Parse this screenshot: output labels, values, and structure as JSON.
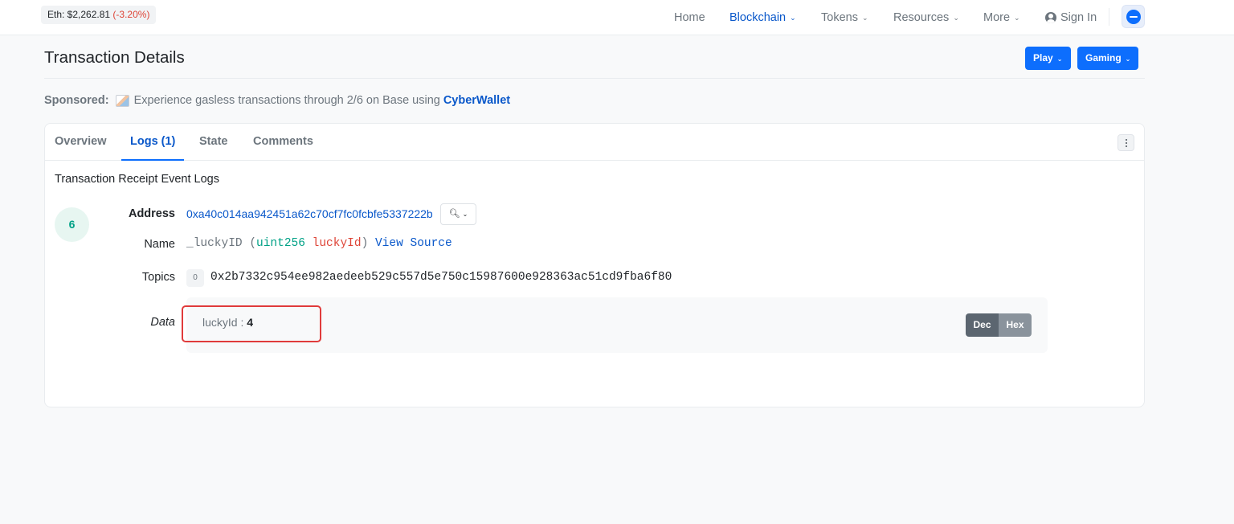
{
  "topbar": {
    "eth_price_label": "Eth: $2,262.81",
    "eth_change": "(-3.20%)",
    "nav": {
      "home": "Home",
      "blockchain": "Blockchain",
      "tokens": "Tokens",
      "resources": "Resources",
      "more": "More",
      "sign_in": "Sign In"
    }
  },
  "header": {
    "title": "Transaction Details",
    "play_button": "Play",
    "gaming_button": "Gaming"
  },
  "sponsored": {
    "label": "Sponsored:",
    "text": "Experience gasless transactions through 2/6 on Base using",
    "brand": "CyberWallet"
  },
  "tabs": [
    "Overview",
    "Logs (1)",
    "State",
    "Comments"
  ],
  "active_tab": "Logs (1)",
  "logs": {
    "heading": "Transaction Receipt Event Logs",
    "entry": {
      "index": "6",
      "address_label": "Address",
      "address": "0xa40c014aa942451a62c70cf7fc0fcbfe5337222b",
      "name_label": "Name",
      "function_name": "_luckyID",
      "param_type": "uint256",
      "param_name": "luckyId",
      "view_source": "View Source",
      "topics_label": "Topics",
      "topic_index": "0",
      "topic_hash": "0x2b7332c954ee982aedeeb529c557d5e750c15987600e928363ac51cd9fba6f80",
      "data_label": "Data",
      "data_key": "luckyId",
      "data_value": "4",
      "dec_label": "Dec",
      "hex_label": "Hex"
    }
  },
  "colors": {
    "accent_blue": "#0d6efd",
    "link_blue": "#0a58ca",
    "negative_red": "#de4437",
    "type_green": "#00a186",
    "highlight_red": "#e03b3b"
  }
}
